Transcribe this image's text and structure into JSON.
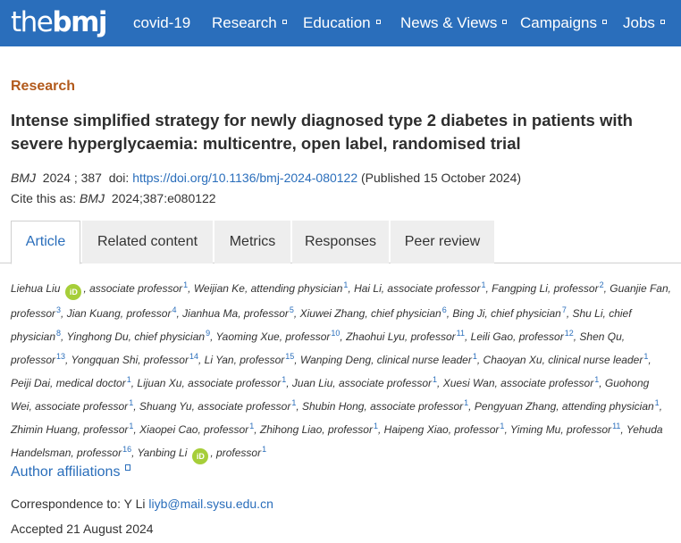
{
  "header": {
    "logo_light": "the",
    "logo_bold": "bmj",
    "nav": [
      {
        "label": "covid-19",
        "has_caret": false
      },
      {
        "label": "Research",
        "has_caret": true
      },
      {
        "label": "Education",
        "has_caret": true
      },
      {
        "label": "News & Views",
        "has_caret": true
      },
      {
        "label": "Campaigns",
        "has_caret": true
      },
      {
        "label": "Jobs",
        "has_caret": true
      }
    ],
    "colors": {
      "bar": "#2a6ebb",
      "text": "#ffffff"
    }
  },
  "article": {
    "section": "Research",
    "title": "Intense simplified strategy for newly diagnosed type 2 diabetes in patients with severe hyperglycaemia: multicentre, open label, randomised trial",
    "journal": "BMJ",
    "year_vol": "2024 ; 387",
    "doi_label": "doi:",
    "doi_url": "https://doi.org/10.1136/bmj-2024-080122",
    "published": "(Published 15 October 2024)",
    "cite_label": "Cite this as:",
    "cite_journal": "BMJ",
    "cite_ref": "2024;387:e080122",
    "colors": {
      "section": "#b25a1c",
      "link": "#2a6ebb"
    }
  },
  "tabs": [
    {
      "label": "Article",
      "active": true
    },
    {
      "label": "Related content",
      "active": false
    },
    {
      "label": "Metrics",
      "active": false
    },
    {
      "label": "Responses",
      "active": false
    },
    {
      "label": "Peer review",
      "active": false
    }
  ],
  "authors": [
    {
      "name": "Liehua Liu",
      "orcid": true,
      "role": "associate professor",
      "aff": "1"
    },
    {
      "name": "Weijian Ke",
      "orcid": false,
      "role": "attending physician",
      "aff": "1"
    },
    {
      "name": "Hai Li",
      "orcid": false,
      "role": "associate professor",
      "aff": "1"
    },
    {
      "name": "Fangping Li",
      "orcid": false,
      "role": "professor",
      "aff": "2"
    },
    {
      "name": "Guanjie Fan",
      "orcid": false,
      "role": "professor",
      "aff": "3"
    },
    {
      "name": "Jian Kuang",
      "orcid": false,
      "role": "professor",
      "aff": "4"
    },
    {
      "name": "Jianhua Ma",
      "orcid": false,
      "role": "professor",
      "aff": "5"
    },
    {
      "name": "Xiuwei Zhang",
      "orcid": false,
      "role": "chief physician",
      "aff": "6"
    },
    {
      "name": "Bing Ji",
      "orcid": false,
      "role": "chief physician",
      "aff": "7"
    },
    {
      "name": "Shu Li",
      "orcid": false,
      "role": "chief physician",
      "aff": "8"
    },
    {
      "name": "Yinghong Du",
      "orcid": false,
      "role": "chief physician",
      "aff": "9"
    },
    {
      "name": "Yaoming Xue",
      "orcid": false,
      "role": "professor",
      "aff": "10"
    },
    {
      "name": "Zhaohui Lyu",
      "orcid": false,
      "role": "professor",
      "aff": "11"
    },
    {
      "name": "Leili Gao",
      "orcid": false,
      "role": "professor",
      "aff": "12"
    },
    {
      "name": "Shen Qu",
      "orcid": false,
      "role": "professor",
      "aff": "13"
    },
    {
      "name": "Yongquan Shi",
      "orcid": false,
      "role": "professor",
      "aff": "14"
    },
    {
      "name": "Li Yan",
      "orcid": false,
      "role": "professor",
      "aff": "15"
    },
    {
      "name": "Wanping Deng",
      "orcid": false,
      "role": "clinical nurse leader",
      "aff": "1"
    },
    {
      "name": "Chaoyan Xu",
      "orcid": false,
      "role": "clinical nurse leader",
      "aff": "1"
    },
    {
      "name": "Peiji Dai",
      "orcid": false,
      "role": "medical doctor",
      "aff": "1"
    },
    {
      "name": "Lijuan Xu",
      "orcid": false,
      "role": "associate professor",
      "aff": "1"
    },
    {
      "name": "Juan Liu",
      "orcid": false,
      "role": "associate professor",
      "aff": "1"
    },
    {
      "name": "Xuesi Wan",
      "orcid": false,
      "role": "associate professor",
      "aff": "1"
    },
    {
      "name": "Guohong Wei",
      "orcid": false,
      "role": "associate professor",
      "aff": "1"
    },
    {
      "name": "Shuang Yu",
      "orcid": false,
      "role": "associate professor",
      "aff": "1"
    },
    {
      "name": "Shubin Hong",
      "orcid": false,
      "role": "associate professor",
      "aff": "1"
    },
    {
      "name": "Pengyuan Zhang",
      "orcid": false,
      "role": "attending physician",
      "aff": "1"
    },
    {
      "name": "Zhimin Huang",
      "orcid": false,
      "role": "professor",
      "aff": "1"
    },
    {
      "name": "Xiaopei Cao",
      "orcid": false,
      "role": "professor",
      "aff": "1"
    },
    {
      "name": "Zhihong Liao",
      "orcid": false,
      "role": "professor",
      "aff": "1"
    },
    {
      "name": "Haipeng Xiao",
      "orcid": false,
      "role": "professor",
      "aff": "1"
    },
    {
      "name": "Yiming Mu",
      "orcid": false,
      "role": "professor",
      "aff": "11"
    },
    {
      "name": "Yehuda Handelsman",
      "orcid": false,
      "role": "professor",
      "aff": "16"
    },
    {
      "name": "Yanbing Li",
      "orcid": true,
      "role": "professor",
      "aff": "1"
    }
  ],
  "orcid_label": "iD",
  "affiliations_label": "Author affiliations",
  "correspondence": {
    "label": "Correspondence to: Y Li",
    "email": "liyb@mail.sysu.edu.cn"
  },
  "accepted": "Accepted 21 August 2024"
}
